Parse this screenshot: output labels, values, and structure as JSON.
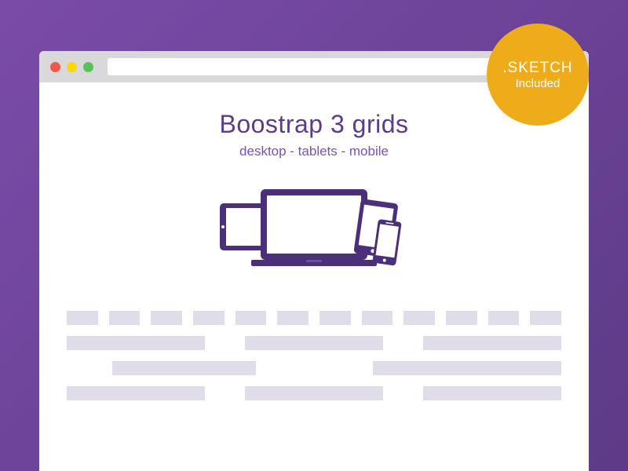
{
  "badge": {
    "title": ".SKETCH",
    "subtitle": "Included"
  },
  "page": {
    "heading": "Boostrap 3 grids",
    "subheading": "desktop - tablets - mobile"
  },
  "colors": {
    "accent_purple": "#5c3b8a",
    "badge_orange": "#eeac1a",
    "grid_block": "#e1dce9"
  }
}
